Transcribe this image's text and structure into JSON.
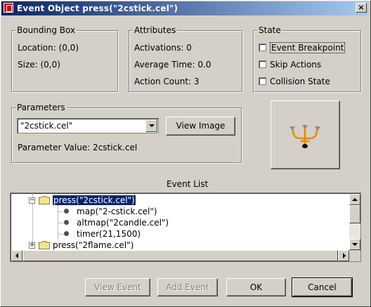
{
  "window": {
    "title": "Event Object  press(\"2cstick.cel\")",
    "icon": "app-icon",
    "close_glyph": "×"
  },
  "bounding_box": {
    "title": "Bounding Box",
    "location": "Location:  (0,0)",
    "size": "Size:  (0,0)"
  },
  "attributes": {
    "title": "Attributes",
    "activations": "Activations:  0",
    "average_time": "Average Time:  0.0",
    "action_count": "Action Count:  3"
  },
  "state": {
    "title": "State",
    "items": [
      {
        "label": "Event Breakpoint",
        "checked": false
      },
      {
        "label": "Skip Actions",
        "checked": false
      },
      {
        "label": "Collision State",
        "checked": false
      }
    ]
  },
  "parameters": {
    "title": "Parameters",
    "combo_value": "\"2cstick.cel\"",
    "view_image_label": "View Image",
    "parameter_value": "Parameter Value:  2cstick.cel"
  },
  "preview": {
    "icon": "candlestick-icon",
    "colors": {
      "body": "#e88a00",
      "base": "#000000",
      "tips": "#8a8a8a"
    }
  },
  "event_list": {
    "title": "Event List",
    "nodes": [
      {
        "label": "press(\"2cstick.cel\")",
        "expanded": true,
        "selected": true
      },
      {
        "label": "map(\"2-cstick.cel\")"
      },
      {
        "label": "altmap(\"2candle.cel\")"
      },
      {
        "label": "timer(21,1500)"
      },
      {
        "label": "press(\"2flame.cel\")",
        "expanded": false
      }
    ]
  },
  "buttons": {
    "view_event": "View Event",
    "add_event": "Add Event",
    "ok": "OK",
    "cancel": "Cancel"
  },
  "colors": {
    "titlebar_start": "#0a246a",
    "titlebar_end": "#a6caf0",
    "selection": "#0a246a"
  }
}
